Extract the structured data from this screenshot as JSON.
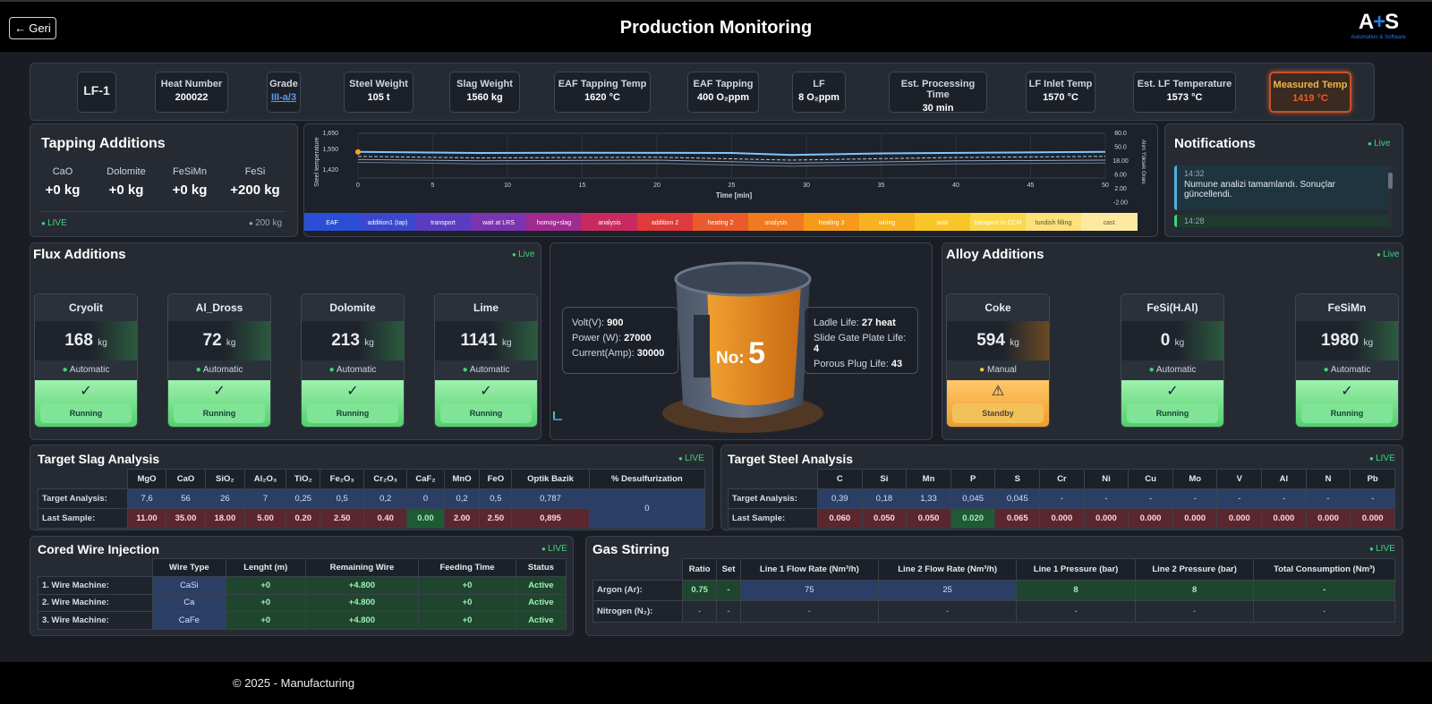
{
  "header": {
    "back_label": "Geri",
    "title": "Production Monitoring",
    "logo": "A+S",
    "logo_sub": "Automation & Software"
  },
  "info": {
    "unit": "LF-1",
    "chips": [
      {
        "label": "Heat Number",
        "value": "200022"
      },
      {
        "label": "Grade",
        "value": "III-a/3"
      },
      {
        "label": "Steel Weight",
        "value": "105 t"
      },
      {
        "label": "Slag Weight",
        "value": "1560 kg"
      },
      {
        "label": "EAF Tapping Temp",
        "value": "1620 °C"
      },
      {
        "label": "EAF Tapping",
        "value": "400 O₂ppm"
      },
      {
        "label": "LF",
        "value": "8 O₂ppm"
      },
      {
        "label": "Est. Processing Time",
        "value": "30 min"
      },
      {
        "label": "LF Inlet Temp",
        "value": "1570 °C"
      },
      {
        "label": "Est. LF Temperature",
        "value": "1573 °C"
      },
      {
        "label": "Measured Temp",
        "value": "1419 °C"
      }
    ]
  },
  "tapping": {
    "title": "Tapping Additions",
    "items": [
      {
        "label": "CaO",
        "value": "+0 kg"
      },
      {
        "label": "Dolomite",
        "value": "+0 kg"
      },
      {
        "label": "FeSiMn",
        "value": "+0 kg"
      },
      {
        "label": "FeSi",
        "value": "+200 kg"
      }
    ],
    "live": "LIVE",
    "total": "200 kg"
  },
  "chart_data": {
    "type": "line",
    "xlabel": "Time [min]",
    "ylabel": "Steel temperature",
    "y2label": "Alım Yüksek Oranı",
    "x_ticks": [
      0,
      5,
      10,
      15,
      20,
      25,
      30,
      35,
      40,
      45,
      50
    ],
    "y_ticks": [
      "1,650",
      "1,550",
      "1,420"
    ],
    "y2_ticks": [
      "80.0",
      "50.0",
      "18.00",
      "6.00",
      "2.00",
      "-2.00"
    ],
    "ylim": [
      1400,
      1700
    ],
    "xlim": [
      0,
      50
    ],
    "series": [
      {
        "values": [
          [
            0,
            1575
          ],
          [
            8,
            1568
          ],
          [
            15,
            1570
          ],
          [
            25,
            1568
          ],
          [
            29,
            1555
          ],
          [
            35,
            1565
          ],
          [
            50,
            1575
          ]
        ]
      },
      {
        "values": [
          [
            0,
            1545
          ],
          [
            8,
            1535
          ],
          [
            20,
            1540
          ],
          [
            29,
            1520
          ],
          [
            40,
            1538
          ],
          [
            50,
            1545
          ]
        ]
      },
      {
        "values": [
          [
            0,
            1525
          ],
          [
            8,
            1515
          ],
          [
            20,
            1520
          ],
          [
            29,
            1500
          ],
          [
            40,
            1515
          ],
          [
            50,
            1520
          ]
        ]
      },
      {
        "values": [
          [
            0,
            1505
          ],
          [
            8,
            1495
          ],
          [
            20,
            1498
          ],
          [
            29,
            1480
          ],
          [
            40,
            1495
          ],
          [
            50,
            1500
          ]
        ]
      }
    ],
    "phases": [
      "EAF",
      "addition1 (tap)",
      "transport",
      "wait at LRS",
      "homog+slag",
      "analysis",
      "addition 2",
      "heating 2",
      "analysis",
      "heating 3",
      "wiring",
      "wait",
      "transport to CCM",
      "tundish filling",
      "cast"
    ]
  },
  "notifications": {
    "title": "Notifications",
    "live": "Live",
    "items": [
      {
        "time": "14:32",
        "text": "Numune analizi tamamlandı. Sonuçlar güncellendi."
      },
      {
        "time": "14:28",
        "text": ""
      }
    ]
  },
  "flux": {
    "title": "Flux Additions",
    "live": "Live",
    "unit": "kg",
    "cards": [
      {
        "name": "Cryolit",
        "value": "168",
        "mode": "Automatic",
        "status": "Running"
      },
      {
        "name": "Al_Dross",
        "value": "72",
        "mode": "Automatic",
        "status": "Running"
      },
      {
        "name": "Dolomite",
        "value": "213",
        "mode": "Automatic",
        "status": "Running"
      },
      {
        "name": "Lime",
        "value": "1141",
        "mode": "Automatic",
        "status": "Running"
      }
    ]
  },
  "furnace": {
    "number_label": "No:",
    "number": "5",
    "left": [
      {
        "label": "Volt(V):",
        "value": "900"
      },
      {
        "label": "Power (W):",
        "value": "27000"
      },
      {
        "label": "Current(Amp):",
        "value": "30000"
      }
    ],
    "right": [
      {
        "label": "Ladle Life:",
        "value": "27 heat"
      },
      {
        "label": "Slide Gate Plate Life:",
        "value": "4"
      },
      {
        "label": "Porous Plug Life:",
        "value": "43"
      }
    ]
  },
  "alloy": {
    "title": "Alloy Additions",
    "live": "Live",
    "unit": "kg",
    "cards": [
      {
        "name": "Coke",
        "value": "594",
        "mode": "Manual",
        "status": "Standby"
      },
      {
        "name": "FeSi(H.Al)",
        "value": "0",
        "mode": "Automatic",
        "status": "Running"
      },
      {
        "name": "FeSiMn",
        "value": "1980",
        "mode": "Automatic",
        "status": "Running"
      }
    ]
  },
  "slag": {
    "title": "Target Slag Analysis",
    "live": "LIVE",
    "columns": [
      "MgO",
      "CaO",
      "SiO₂",
      "Al₂O₃",
      "TiO₂",
      "Fe₂O₃",
      "Cr₂O₃",
      "CaF₂",
      "MnO",
      "FeO",
      "Optik Bazik",
      "% Desulfurization"
    ],
    "rows": [
      {
        "label": "Target Analysis:",
        "values": [
          "7,6",
          "56",
          "26",
          "7",
          "0,25",
          "0,5",
          "0,2",
          "0",
          "0,2",
          "0,5",
          "0,787"
        ]
      },
      {
        "label": "Last Sample:",
        "values": [
          "11.00",
          "35.00",
          "18.00",
          "5.00",
          "0.20",
          "2.50",
          "0.40",
          "0.00",
          "2.00",
          "2.50",
          "0,895"
        ]
      }
    ],
    "desulf": "0"
  },
  "steel": {
    "title": "Target Steel Analysis",
    "live": "LIVE",
    "columns": [
      "C",
      "Si",
      "Mn",
      "P",
      "S",
      "Cr",
      "Ni",
      "Cu",
      "Mo",
      "V",
      "Al",
      "N",
      "Pb"
    ],
    "rows": [
      {
        "label": "Target Analysis:",
        "values": [
          "0,39",
          "0,18",
          "1,33",
          "0,045",
          "0,045",
          "-",
          "-",
          "-",
          "-",
          "-",
          "-",
          "-",
          "-"
        ]
      },
      {
        "label": "Last Sample:",
        "values": [
          "0.060",
          "0.050",
          "0.050",
          "0.020",
          "0.065",
          "0.000",
          "0.000",
          "0.000",
          "0.000",
          "0.000",
          "0.000",
          "0.000",
          "0.000"
        ]
      }
    ]
  },
  "wire": {
    "title": "Cored Wire Injection",
    "live": "LIVE",
    "columns": [
      "Wire Type",
      "Lenght (m)",
      "Remaining Wire",
      "Feeding Time",
      "Status"
    ],
    "rows": [
      {
        "label": "1. Wire Machine:",
        "values": [
          "CaSi",
          "+0",
          "+4.800",
          "+0",
          "Active"
        ]
      },
      {
        "label": "2. Wire Machine:",
        "values": [
          "Ca",
          "+0",
          "+4.800",
          "+0",
          "Active"
        ]
      },
      {
        "label": "3. Wire Machine:",
        "values": [
          "CaFe",
          "+0",
          "+4.800",
          "+0",
          "Active"
        ]
      }
    ]
  },
  "gas": {
    "title": "Gas Stirring",
    "live": "LIVE",
    "columns": [
      "Ratio",
      "Set",
      "Line 1 Flow Rate (Nm³/h)",
      "Line 2 Flow Rate (Nm³/h)",
      "Line 1 Pressure (bar)",
      "Line 2 Pressure (bar)",
      "Total Consumption (Nm³)"
    ],
    "rows": [
      {
        "label": "Argon (Ar):",
        "values": [
          "0.75",
          "-",
          "75",
          "25",
          "8",
          "8",
          "-"
        ]
      },
      {
        "label": "Nitrogen (N₂):",
        "values": [
          "-",
          "-",
          "-",
          "-",
          "-",
          "-",
          "-"
        ]
      }
    ]
  },
  "footer": {
    "text": "© 2025 - Manufacturing"
  }
}
